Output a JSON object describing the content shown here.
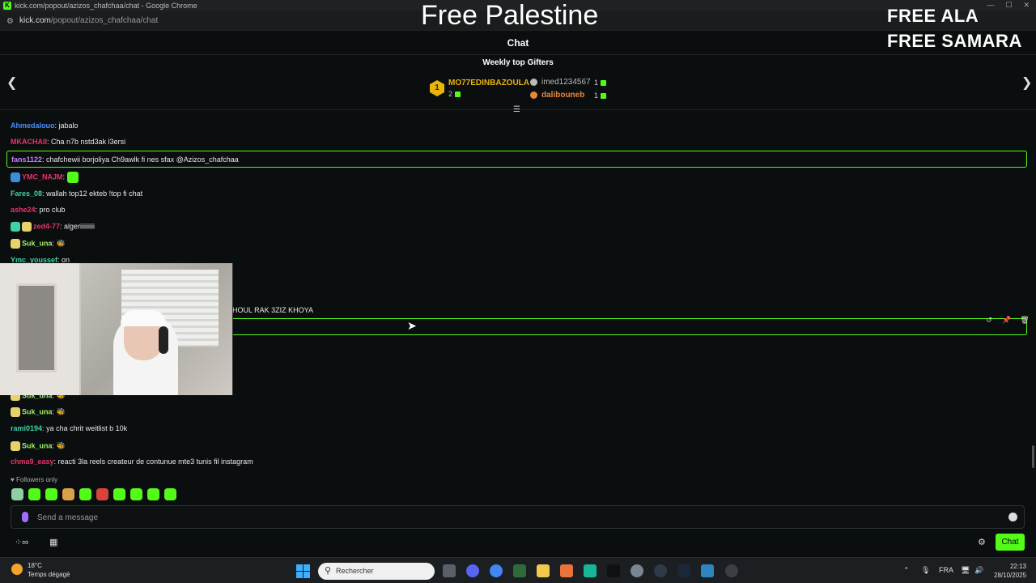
{
  "window": {
    "title": "kick.com/popout/azizos_chafchaa/chat - Google Chrome",
    "url_domain": "kick.com",
    "url_path": "/popout/azizos_chafchaa/chat"
  },
  "overlay": {
    "center_text": "Free Palestine",
    "right_line1": "FREE ALA",
    "right_line2": "FREE SAMARA"
  },
  "chat": {
    "header": "Chat",
    "gifters_title": "Weekly top Gifters",
    "top_gifter": {
      "rank": "1",
      "name": "MO77EDINBAZOULA",
      "count": "2"
    },
    "gifter2": {
      "name": "imed1234567",
      "count": "1"
    },
    "gifter3": {
      "name": "dalibouneb",
      "count": "1"
    },
    "messages": [
      {
        "user": "Ahmedalouo",
        "text": "jabalo",
        "color": "#4a8cff"
      },
      {
        "user": "MKACHAII",
        "text": "Cha n7b nstd3ak l3ersi",
        "color": "#e8336a"
      },
      {
        "user": "fans1122",
        "text": "chafchewii borjoliya Ch9awlk fi nes sfax @Azizos_chafchaa",
        "color": "#c77dff"
      },
      {
        "user": "YMC_NAJM",
        "text": "",
        "color": "#e8336a"
      },
      {
        "user": "Fares_08",
        "text": "wallah top12 ekteb !top fi chat",
        "color": "#3fd1a8"
      },
      {
        "user": "ashe24",
        "text": "pro club",
        "color": "#e8336a"
      },
      {
        "user": "zed4-77",
        "text": "algeriiiiiiiii",
        "color": "#e8336a"
      },
      {
        "user": "Suk_una",
        "text": "🐝",
        "color": "#9bf06b"
      },
      {
        "user": "Ymc_youssef",
        "text": "on",
        "color": "#3fd1a8"
      },
      {
        "user": "",
        "text": "HOUL RAK 3ZIZ KHOYA",
        "color": "#e8e8e8"
      },
      {
        "user": "Suk_una",
        "text": "🐝",
        "color": "#9bf06b"
      },
      {
        "user": "Suk_una",
        "text": "🐝",
        "color": "#9bf06b"
      },
      {
        "user": "rami0194",
        "text": "ya cha chrit weitlist b 10k",
        "color": "#3fd1a8"
      },
      {
        "user": "Suk_una",
        "text": "🐝",
        "color": "#9bf06b"
      },
      {
        "user": "chma9_easy",
        "text": "reacti 3la reels createur de contunue mte3 tunis fil instagram",
        "color": "#e8336a"
      }
    ],
    "followers_only": "Followers only",
    "input_placeholder": "Send a message",
    "send_button": "Chat"
  },
  "taskbar": {
    "temperature": "18°C",
    "weather": "Temps dégagé",
    "search_placeholder": "Rechercher",
    "language": "FRA",
    "time": "22:13",
    "date": "28/10/2025"
  },
  "colors": {
    "accent": "#53fc18",
    "background": "#0b0e0f",
    "gold": "#e8b30a"
  }
}
